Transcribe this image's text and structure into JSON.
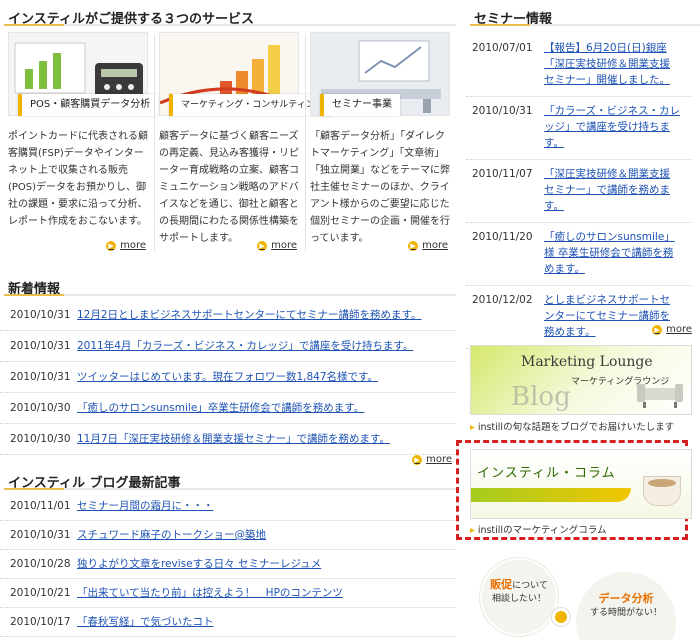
{
  "services": {
    "heading": "インスティルがご提供する３つのサービス",
    "items": [
      {
        "label": "POS・顧客購買データ分析",
        "desc": "ポイントカードに代表される顧客購買(FSP)データやインターネット上で収集される販売(POS)データをお預かりし、御社の課題・要求に沿って分析、レポート作成をおこないます。",
        "more": "more"
      },
      {
        "label": "マーケティング・コンサルティング",
        "desc": "顧客データに基づく顧客ニーズの再定義、見込み客獲得・リピーター育成戦略の立案、顧客コミュニケーション戦略のアドバイスなどを通じ、御社と顧客との長期間にわたる関係性構築をサポートします。",
        "more": "more"
      },
      {
        "label": "セミナー事業",
        "desc": "「顧客データ分析」「ダイレクトマーケティング」「文章術」「独立開業」などをテーマに弊社主催セミナーのほか、クライアント様からのご要望に応じた個別セミナーの企画・開催を行っています。",
        "more": "more"
      }
    ]
  },
  "news": {
    "heading": "新着情報",
    "more": "more",
    "items": [
      {
        "date": "2010/10/31",
        "text": "12月2日としまビジネスサポートセンターにてセミナー講師を務めます。"
      },
      {
        "date": "2010/10/31",
        "text": "2011年4月「カラーズ・ビジネス・カレッジ」で講座を受け持ちます。"
      },
      {
        "date": "2010/10/31",
        "text": "ツイッターはじめています。現在フォロワー数1,847名様です。"
      },
      {
        "date": "2010/10/30",
        "text": "「癒しのサロンsunsmile」卒業生研修会で講師を務めます。"
      },
      {
        "date": "2010/10/30",
        "text": "11月7日「深圧実技研修＆開業支援セミナー」で講師を務めます。"
      }
    ]
  },
  "blog": {
    "heading": "インスティル ブログ最新記事",
    "items": [
      {
        "date": "2010/11/01",
        "text": "セミナー月間の霜月に・・・"
      },
      {
        "date": "2010/10/31",
        "text": "スチュワード麻子のトークショー@築地"
      },
      {
        "date": "2010/10/28",
        "text": "独りよがり文章をreviseする日々 セミナーレジュメ"
      },
      {
        "date": "2010/10/21",
        "text": "「出来ていて当たり前」は控えよう！　HPのコンテンツ"
      },
      {
        "date": "2010/10/17",
        "text": "「春秋写経」で気づいたコト"
      }
    ]
  },
  "seminar": {
    "heading": "セミナー情報",
    "more": "more",
    "items": [
      {
        "date": "2010/07/01",
        "text": "【報告】6月20日(日)銀座「深圧実技研修＆開業支援セミナー」開催しました。"
      },
      {
        "date": "2010/10/31",
        "text": "「カラーズ・ビジネス・カレッジ」で講座を受け持ちます。"
      },
      {
        "date": "2010/11/07",
        "text": "「深圧実技研修＆開業支援セミナー」で講師を務めます。"
      },
      {
        "date": "2010/11/20",
        "text": "「癒しのサロンsunsmile」様 卒業生研修会で講師を務めます。"
      },
      {
        "date": "2010/12/02",
        "text": "としまビジネスサポートセンターにてセミナー講師を務めます。"
      }
    ]
  },
  "banners": {
    "lounge_title": "Marketing Lounge",
    "lounge_sub": "マーケティングラウンジ",
    "lounge_blog": "Blog",
    "lounge_caption": "instillの旬な話題をブログでお届けいたします",
    "column_title": "インスティル・コラム",
    "column_caption": "instillのマーケティングコラム"
  },
  "bubbles": {
    "b1_strong": "販促",
    "b1_text1": "について",
    "b1_text2": "相談したい！",
    "b2_strong": "データ分析",
    "b2_text": "する時間がない！"
  },
  "colors": {
    "accent": "#f0b400",
    "link": "#1f53b4",
    "highlight": "#d61f1f"
  }
}
